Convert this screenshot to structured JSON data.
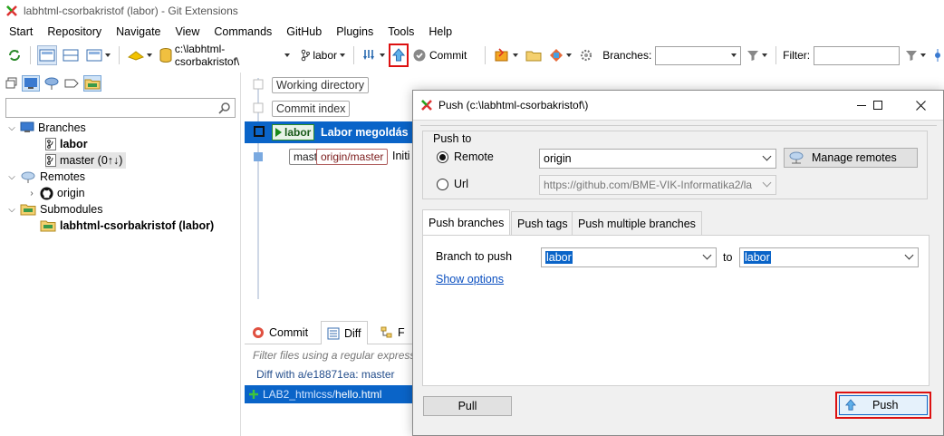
{
  "window": {
    "title": "labhtml-csorbakristof (labor) - Git Extensions"
  },
  "menu": [
    "Start",
    "Repository",
    "Navigate",
    "View",
    "Commands",
    "GitHub",
    "Plugins",
    "Tools",
    "Help"
  ],
  "toolbar": {
    "repo_path": "c:\\labhtml-csorbakristof\\",
    "branch": "labor",
    "commit_label": "Commit",
    "branches_label": "Branches:",
    "filter_label": "Filter:"
  },
  "left_panel": {
    "search_placeholder": "",
    "tree": {
      "branches": "Branches",
      "branch_labor": "labor",
      "branch_master": "master (0↑↓)",
      "remotes": "Remotes",
      "remote_origin": "origin",
      "submodules": "Submodules",
      "submodule": "labhtml-csorbakristof (labor)"
    }
  },
  "graph": {
    "working_directory": "Working directory",
    "commit_index": "Commit index",
    "selected_branch_tag": "labor",
    "selected_message": "Labor megoldás",
    "tag_master": "master",
    "tag_origin_master": "origin/master",
    "initial_message": "Initi"
  },
  "bottom": {
    "tab_commit": "Commit",
    "tab_diff": "Diff",
    "tab_f": "F",
    "filter_placeholder": "Filter files using a regular express",
    "diff_with": "Diff with a/e18871ea: master",
    "file_path": "LAB2_htmlcss/",
    "file_name": "hello.html"
  },
  "dialog": {
    "title": "Push (c:\\labhtml-csorbakristof\\)",
    "push_to_label": "Push to",
    "remote_label": "Remote",
    "remote_value": "origin",
    "manage_remotes": "Manage remotes",
    "url_label": "Url",
    "url_value": "https://github.com/BME-VIK-Informatika2/la",
    "tabs": [
      "Push branches",
      "Push tags",
      "Push multiple branches"
    ],
    "branch_to_push_label": "Branch to push",
    "branch_to_push_value": "labor",
    "to_label": "to",
    "target_branch_value": "labor",
    "show_options": "Show options",
    "pull_button": "Pull",
    "push_button": "Push"
  },
  "colors": {
    "selection": "#0a64c8",
    "highlight": "#dd1111",
    "branch_green": "#1a7a1a",
    "remote_red": "#8b1a1a"
  }
}
